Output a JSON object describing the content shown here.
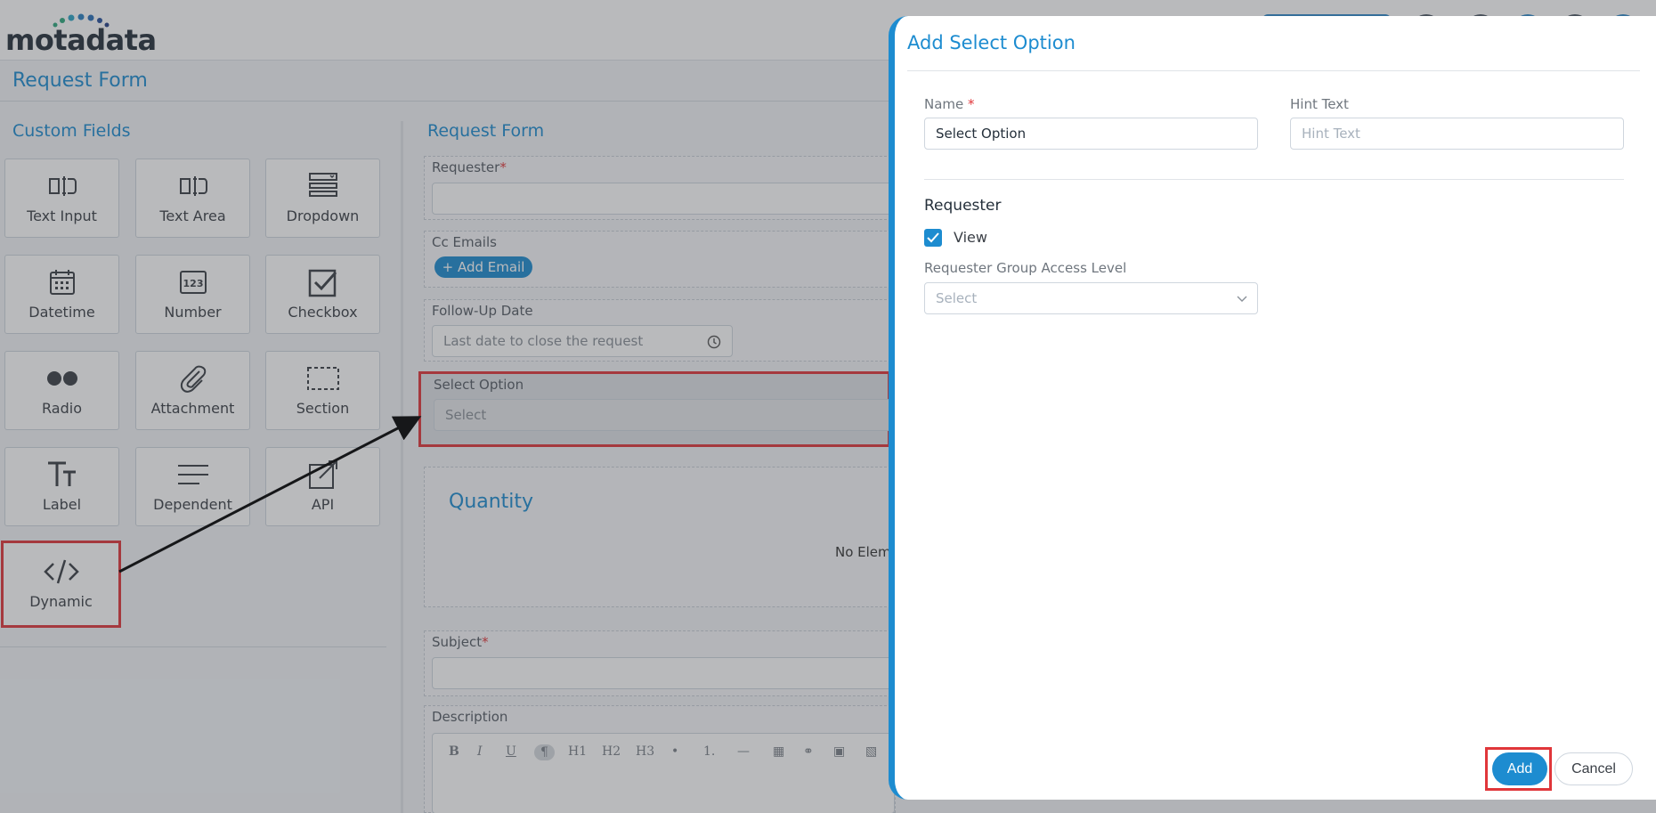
{
  "app": {
    "logo_text": "motadata",
    "page_title": "Request Form"
  },
  "custom_fields": {
    "heading": "Custom Fields",
    "tiles": [
      {
        "label": "Text Input",
        "icon": "text-input-icon"
      },
      {
        "label": "Text Area",
        "icon": "text-area-icon"
      },
      {
        "label": "Dropdown",
        "icon": "dropdown-icon"
      },
      {
        "label": "Datetime",
        "icon": "calendar-icon"
      },
      {
        "label": "Number",
        "icon": "number-icon"
      },
      {
        "label": "Checkbox",
        "icon": "checkbox-icon"
      },
      {
        "label": "Radio",
        "icon": "radio-icon"
      },
      {
        "label": "Attachment",
        "icon": "paperclip-icon"
      },
      {
        "label": "Section",
        "icon": "section-icon"
      },
      {
        "label": "Label",
        "icon": "label-icon"
      },
      {
        "label": "Dependent",
        "icon": "dependent-icon"
      },
      {
        "label": "API",
        "icon": "api-icon"
      },
      {
        "label": "Dynamic",
        "icon": "code-icon"
      }
    ]
  },
  "request_form": {
    "heading": "Request Form",
    "requester_label": "Requester",
    "cc_label": "Cc Emails",
    "add_email": "+ Add Email",
    "followup_label": "Follow-Up Date",
    "followup_placeholder": "Last date to close the request",
    "select_option_label": "Select Option",
    "select_placeholder": "Select",
    "section_title": "Quantity",
    "no_elements": "No Elem",
    "subject_label": "Subject",
    "description_label": "Description",
    "toolbar": [
      "B",
      "I",
      "U",
      "¶",
      "H1",
      "H2",
      "H3",
      "•",
      "1.",
      "—",
      "▦",
      "⚭",
      "▣",
      "▧"
    ]
  },
  "dialog": {
    "title": "Add Select Option",
    "name_label": "Name",
    "name_value": "Select Option",
    "hint_label": "Hint Text",
    "hint_placeholder": "Hint Text",
    "section": "Requester",
    "view_label": "View",
    "view_checked": true,
    "access_level_label": "Requester Group Access Level",
    "access_placeholder": "Select",
    "add_button": "Add",
    "cancel_button": "Cancel"
  },
  "colors": {
    "accent": "#1d8cd0",
    "highlight": "#e0363a"
  }
}
